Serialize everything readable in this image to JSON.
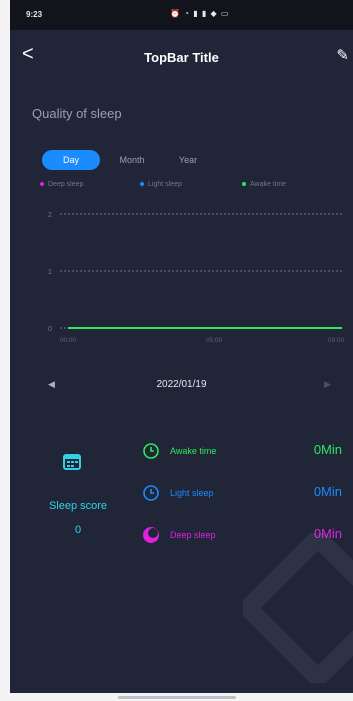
{
  "status": {
    "time": "9:23",
    "icons": "⏰ ◔ ▮ ▮ ◆ ▭"
  },
  "topbar": {
    "back": "<",
    "title": "TopBar Title",
    "edit": "✎"
  },
  "section_title": "Quality of sleep",
  "tabs": [
    {
      "label": "Day",
      "active": true
    },
    {
      "label": "Month",
      "active": false
    },
    {
      "label": "Year",
      "active": false
    }
  ],
  "legend": [
    {
      "label": "Deep sleep",
      "color": "#e020e0"
    },
    {
      "label": "Light sleep",
      "color": "#1a8cff"
    },
    {
      "label": "Awake time",
      "color": "#2ee85a"
    }
  ],
  "chart_data": {
    "type": "line",
    "y_ticks": [
      "2",
      "1",
      "0"
    ],
    "x_ticks": [
      "00:00",
      "05:00",
      "09:00"
    ],
    "ylim": [
      0,
      2
    ],
    "series": [
      {
        "name": "Awake time",
        "values": [
          0,
          0,
          0
        ],
        "color": "#2ee85a"
      }
    ],
    "grid": "dashed"
  },
  "date_nav": {
    "prev": "◀",
    "date": "2022/01/19",
    "next": "▶"
  },
  "score": {
    "label": "Sleep score",
    "value": "0"
  },
  "stats": [
    {
      "label": "Awake time",
      "value": "0Min",
      "color": "#2ee85a",
      "icon": "clock-icon"
    },
    {
      "label": "Light sleep",
      "value": "0Min",
      "color": "#1a8cff",
      "icon": "clock-icon"
    },
    {
      "label": "Deep sleep",
      "value": "0Min",
      "color": "#e020e0",
      "icon": "moon-icon"
    }
  ]
}
